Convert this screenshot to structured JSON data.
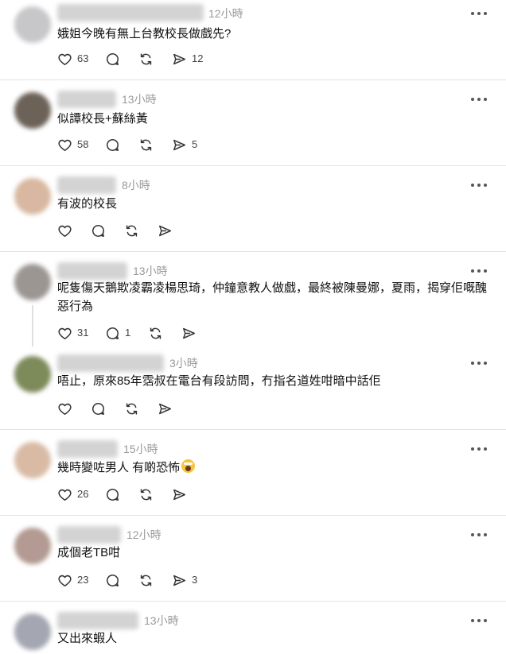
{
  "icons": {
    "like": "heart-icon",
    "reply": "comment-bubble-icon",
    "repost": "repost-icon",
    "share": "send-icon",
    "more": "more-horizontal-icon"
  },
  "colors": {
    "background": "#ffffff",
    "divider": "#e3e3e3",
    "timestamp": "#9a9a9a",
    "icon": "#333333"
  },
  "comments": [
    {
      "time": "12小時",
      "text": "娥姐今晚有無上台教校長做戲先?",
      "likes": "63",
      "replies": "",
      "shares": "12"
    },
    {
      "time": "13小時",
      "text": "似譚校長+蘇絲黃",
      "likes": "58",
      "replies": "",
      "shares": "5"
    },
    {
      "time": "8小時",
      "text": "有波的校長",
      "likes": "",
      "replies": "",
      "shares": ""
    },
    {
      "time": "13小時",
      "text": "呢隻傷天鵝欺凌霸凌楊思琦，仲鐘意教人做戲，最終被陳曼娜，夏雨，揭穿佢嘅醜惡行為",
      "likes": "31",
      "replies": "1",
      "shares": ""
    },
    {
      "time": "3小時",
      "text": "唔止，原來85年霑叔在電台有段訪問，冇指名道姓咁暗中話佢",
      "likes": "",
      "replies": "",
      "shares": ""
    },
    {
      "time": "15小時",
      "text": "幾時變咗男人 有啲恐怖",
      "emoji": "screaming-face-emoji",
      "likes": "26",
      "replies": "",
      "shares": ""
    },
    {
      "time": "12小時",
      "text": "成個老TB咁",
      "likes": "23",
      "replies": "",
      "shares": "3"
    },
    {
      "time": "13小時",
      "text": "又出來蝦人",
      "likes": "",
      "replies": "",
      "shares": ""
    }
  ]
}
